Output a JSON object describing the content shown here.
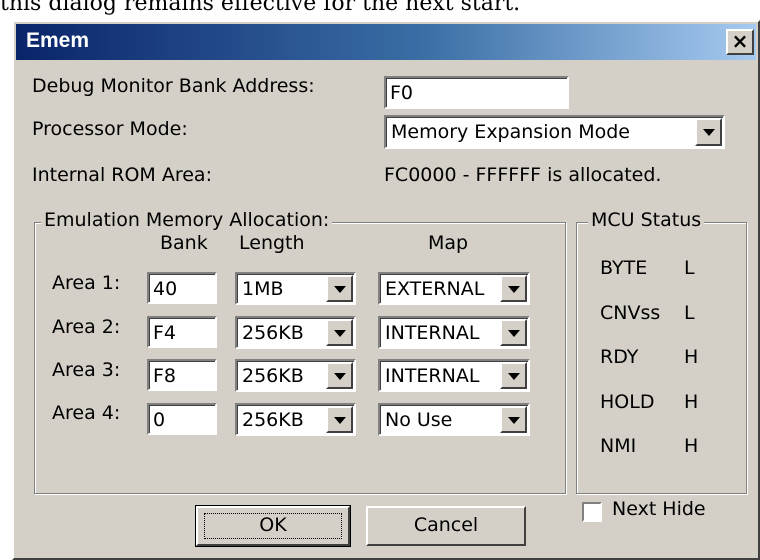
{
  "caption": "this dialog remains effective for the next start.",
  "window": {
    "title": "Emem",
    "close_glyph": "×"
  },
  "debug_monitor": {
    "label": "Debug Monitor Bank Address:",
    "value": "F0"
  },
  "processor_mode": {
    "label": "Processor Mode:",
    "value": "Memory Expansion Mode"
  },
  "internal_rom": {
    "label": "Internal ROM Area:",
    "value": "FC0000 - FFFFFF is allocated."
  },
  "emulation": {
    "title": "Emulation Memory Allocation:",
    "headers": {
      "bank": "Bank",
      "length": "Length",
      "map": "Map"
    },
    "areas": [
      {
        "label": "Area 1:",
        "bank": "40",
        "length": "1MB",
        "map": "EXTERNAL"
      },
      {
        "label": "Area 2:",
        "bank": "F4",
        "length": "256KB",
        "map": "INTERNAL"
      },
      {
        "label": "Area 3:",
        "bank": "F8",
        "length": "256KB",
        "map": "INTERNAL"
      },
      {
        "label": "Area 4:",
        "bank": "0",
        "length": "256KB",
        "map": "No Use"
      }
    ]
  },
  "mcu_status": {
    "title": "MCU Status",
    "rows": [
      {
        "name": "BYTE",
        "value": "L"
      },
      {
        "name": "CNVss",
        "value": "L"
      },
      {
        "name": "RDY",
        "value": "H"
      },
      {
        "name": "HOLD",
        "value": "H"
      },
      {
        "name": "NMI",
        "value": "H"
      }
    ]
  },
  "buttons": {
    "ok": "OK",
    "cancel": "Cancel"
  },
  "next_hide": {
    "label": "Next Hide",
    "checked": false
  },
  "colors": {
    "face": "#d4d0c8",
    "title_start": "#0a246a",
    "title_end": "#a6caf0"
  }
}
